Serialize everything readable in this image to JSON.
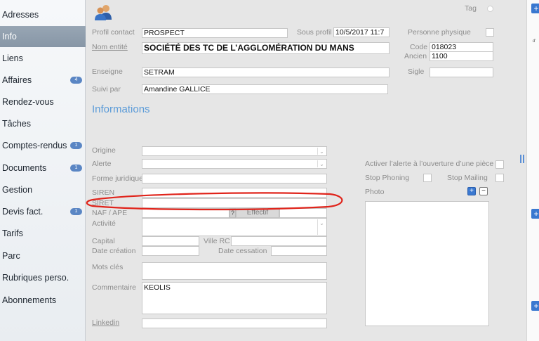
{
  "sidebar": {
    "items": [
      {
        "label": "Adresses",
        "badge": null,
        "selected": false
      },
      {
        "label": "Info",
        "badge": null,
        "selected": true
      },
      {
        "label": "Liens",
        "badge": null,
        "selected": false
      },
      {
        "label": "Affaires",
        "badge": "4",
        "selected": false
      },
      {
        "label": "Rendez-vous",
        "badge": null,
        "selected": false
      },
      {
        "label": "Tâches",
        "badge": null,
        "selected": false
      },
      {
        "label": "Comptes-rendus",
        "badge": "1",
        "selected": false
      },
      {
        "label": "Documents",
        "badge": "1",
        "selected": false
      },
      {
        "label": "Gestion",
        "badge": null,
        "selected": false
      },
      {
        "label": "Devis fact.",
        "badge": "1",
        "selected": false
      },
      {
        "label": "Tarifs",
        "badge": null,
        "selected": false
      },
      {
        "label": "Parc",
        "badge": null,
        "selected": false
      },
      {
        "label": "Rubriques perso.",
        "badge": null,
        "selected": false
      },
      {
        "label": "Abonnements",
        "badge": null,
        "selected": false
      }
    ]
  },
  "header": {
    "icon": "contacts-icon",
    "tag_label": "Tag"
  },
  "identity": {
    "profil_contact_label": "Profil contact",
    "profil_contact_value": "PROSPECT",
    "sous_profil_label": "Sous profil",
    "sous_profil_value": "10/5/2017 11:7",
    "personne_physique_label": "Personne physique",
    "nom_entite_label": "Nom entité",
    "nom_entite_value": "SOCIÉTÉ DES TC DE L’AGGLOMÉRATION DU MANS",
    "code_label": "Code",
    "code_value": "018023",
    "ancien_label": "Ancien",
    "ancien_value": "1100",
    "enseigne_label": "Enseigne",
    "enseigne_value": "SETRAM",
    "sigle_label": "Sigle",
    "sigle_value": "",
    "suivi_par_label": "Suivi par",
    "suivi_par_value": "Amandine GALLICE"
  },
  "informations": {
    "heading": "Informations",
    "origine_label": "Origine",
    "alerte_label": "Alerte",
    "forme_juridique_label": "Forme juridique",
    "siren_label": "SIREN",
    "siret_label": "SIRET",
    "naf_label": "NAF / APE",
    "question_mark": "?",
    "effectif_label": "Effectif",
    "activite_label": "Activité",
    "capital_label": "Capital",
    "ville_rc_label": "Ville RC",
    "date_creation_label": "Date création",
    "date_cessation_label": "Date cessation",
    "mots_cles_label": "Mots clés",
    "commentaire_label": "Commentaire",
    "commentaire_value": "KEOLIS",
    "linkedin_label": "Linkedin"
  },
  "right_panel": {
    "activer_alerte_label": "Activer l’alerte à l’ouverture d’une pièce",
    "stop_phoning_label": "Stop Phoning",
    "stop_mailing_label": "Stop Mailing",
    "photo_label": "Photo",
    "photo_add": "+",
    "photo_remove": "−"
  },
  "right_strip": {
    "plus": "+",
    "fragment": "d'"
  },
  "colors": {
    "accent": "#5b9bd8",
    "selected_nav": "#8f9dac",
    "badge": "#5a86c4",
    "annotation": "#e0241b"
  }
}
